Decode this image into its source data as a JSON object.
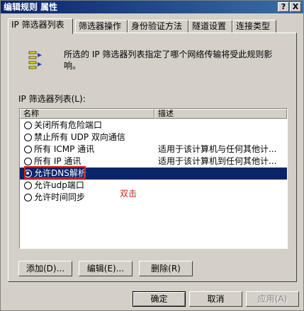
{
  "window": {
    "title": "编辑规则 属性",
    "help_button": "?",
    "close_button": "X"
  },
  "tabs": [
    {
      "label": "IP 筛选器列表",
      "active": true
    },
    {
      "label": "筛选器操作",
      "active": false
    },
    {
      "label": "身份验证方法",
      "active": false
    },
    {
      "label": "隧道设置",
      "active": false
    },
    {
      "label": "连接类型",
      "active": false
    }
  ],
  "panel": {
    "description": "所选的 IP 筛选器列表指定了哪个网络传输将受此规则影响。",
    "list_label": "IP 筛选器列表(L):",
    "columns": {
      "name": "名称",
      "description": "描述"
    },
    "rows": [
      {
        "name": "关闭所有危险端口",
        "description": "",
        "selected": false
      },
      {
        "name": "禁止所有 UDP 双向通信",
        "description": "",
        "selected": false
      },
      {
        "name": "所有 ICMP 通讯",
        "description": "适用于该计算机与任何其他计...",
        "selected": false
      },
      {
        "name": "所有 IP 通讯",
        "description": "适用于该计算机到任何其他计...",
        "selected": false
      },
      {
        "name": "允许DNS解析",
        "description": "",
        "selected": true
      },
      {
        "name": "允许udp端口",
        "description": "",
        "selected": false
      },
      {
        "name": "允许时间同步",
        "description": "",
        "selected": false
      }
    ],
    "annotation": "双击",
    "add_button": "添加(D)...",
    "edit_button": "编辑(E)...",
    "delete_button": "删除(R)"
  },
  "footer": {
    "ok_button": "确定",
    "cancel_button": "取消",
    "apply_button": "应用(A)"
  },
  "colors": {
    "title_bar": "#0a246a",
    "selection": "#0a246a",
    "annotation": "#e02020"
  }
}
